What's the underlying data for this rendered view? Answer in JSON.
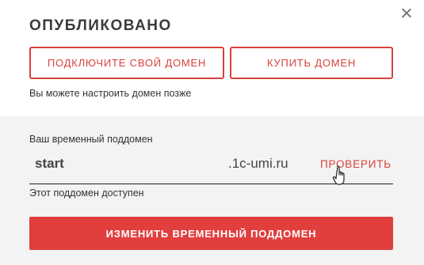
{
  "dialog": {
    "title": "ОПУБЛИКОВАНО",
    "close_icon": "close-icon"
  },
  "actions": {
    "connect_label": "ПОДКЛЮЧИТЕ СВОЙ ДОМЕН",
    "buy_label": "КУПИТЬ ДОМЕН",
    "hint": "Вы можете настроить домен позже"
  },
  "subdomain": {
    "label": "Ваш временный поддомен",
    "value": "start",
    "suffix": ".1c-umi.ru",
    "check_label": "ПРОВЕРИТЬ",
    "status": "Этот поддомен доступен",
    "change_label": "ИЗМЕНИТЬ ВРЕМЕННЫЙ ПОДДОМЕН"
  },
  "colors": {
    "accent": "#e13f3e",
    "outline": "#d8413c",
    "panel_bg": "#f3f3f3"
  },
  "cursor_icon": "hand-pointer-icon"
}
